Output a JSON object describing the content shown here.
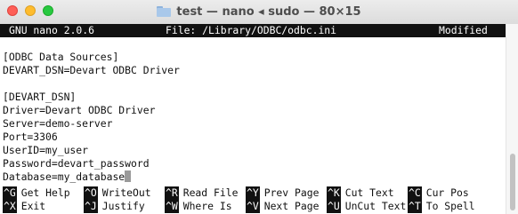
{
  "window": {
    "title": "test — nano ◂ sudo — 80×15"
  },
  "nano": {
    "header": {
      "version": "GNU nano 2.0.6",
      "file": "File: /Library/ODBC/odbc.ini",
      "status": "Modified"
    },
    "lines": [
      "",
      "[ODBC Data Sources]",
      "DEVART_DSN=Devart ODBC Driver",
      "",
      "[DEVART_DSN]",
      "Driver=Devart ODBC Driver",
      "Server=demo-server",
      "Port=3306",
      "UserID=my_user",
      "Password=devart_password",
      "Database=my_database"
    ],
    "shortcuts_row1": [
      {
        "key": "^G",
        "label": "Get Help"
      },
      {
        "key": "^O",
        "label": "WriteOut"
      },
      {
        "key": "^R",
        "label": "Read File"
      },
      {
        "key": "^Y",
        "label": "Prev Page"
      },
      {
        "key": "^K",
        "label": "Cut Text"
      },
      {
        "key": "^C",
        "label": "Cur Pos"
      }
    ],
    "shortcuts_row2": [
      {
        "key": "^X",
        "label": "Exit"
      },
      {
        "key": "^J",
        "label": "Justify"
      },
      {
        "key": "^W",
        "label": "Where Is"
      },
      {
        "key": "^V",
        "label": "Next Page"
      },
      {
        "key": "^U",
        "label": "UnCut Text"
      },
      {
        "key": "^T",
        "label": "To Spell"
      }
    ]
  },
  "icons": {
    "folder": "folder-icon",
    "close": "close-window-button",
    "minimize": "minimize-window-button",
    "zoom": "zoom-window-button"
  },
  "colors": {
    "close": "#fe5f57",
    "minimize": "#febc2e",
    "zoom": "#28c840",
    "header_bg": "#111111",
    "terminal_bg": "#ffffff"
  }
}
